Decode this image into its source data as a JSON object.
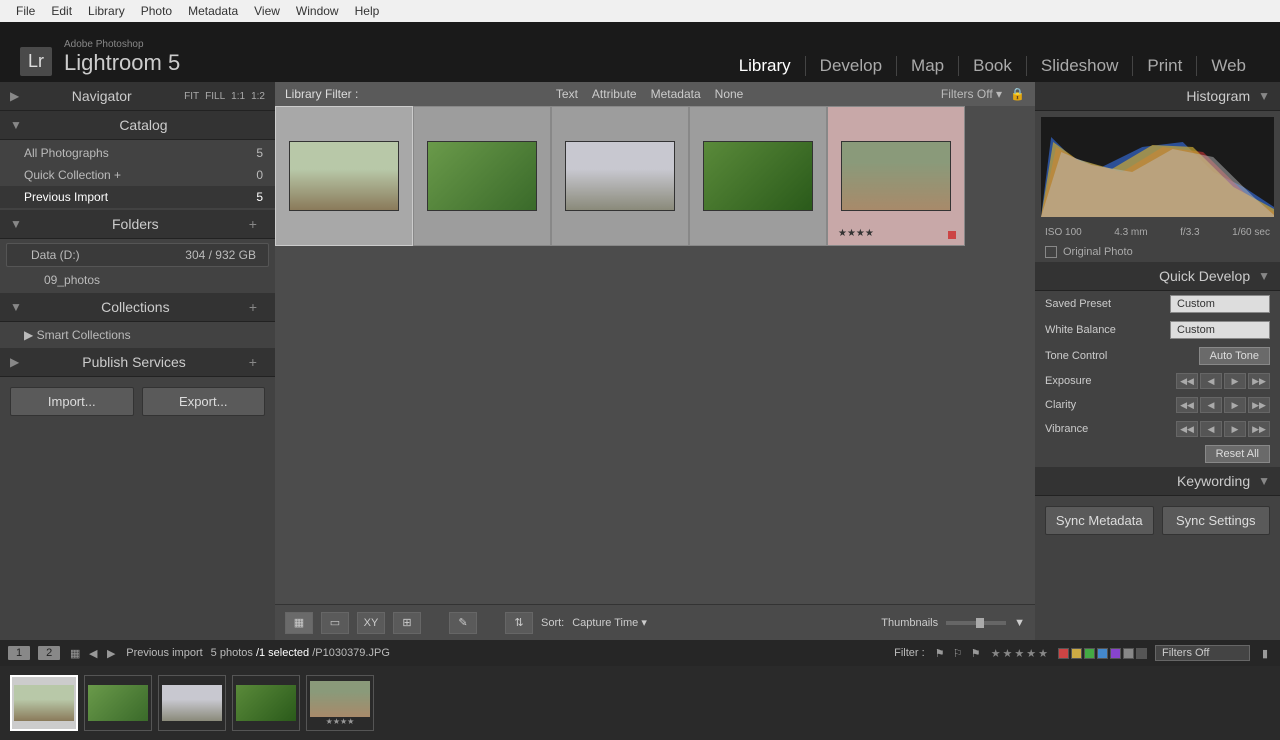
{
  "menubar": {
    "items": [
      "File",
      "Edit",
      "Library",
      "Photo",
      "Metadata",
      "View",
      "Window",
      "Help"
    ]
  },
  "brand": {
    "small": "Adobe Photoshop",
    "big": "Lightroom 5",
    "logo": "Lr"
  },
  "modules": [
    "Library",
    "Develop",
    "Map",
    "Book",
    "Slideshow",
    "Print",
    "Web"
  ],
  "active_module": "Library",
  "navigator": {
    "title": "Navigator",
    "opts": [
      "FIT",
      "FILL",
      "1:1",
      "1:2"
    ]
  },
  "catalog": {
    "title": "Catalog",
    "items": [
      {
        "label": "All Photographs",
        "count": 5
      },
      {
        "label": "Quick Collection  +",
        "count": 0
      },
      {
        "label": "Previous Import",
        "count": 5,
        "selected": true
      }
    ]
  },
  "folders": {
    "title": "Folders",
    "drive": {
      "label": "Data (D:)",
      "space": "304 / 932 GB"
    },
    "children": [
      {
        "label": "09_photos"
      }
    ]
  },
  "collections": {
    "title": "Collections",
    "items": [
      {
        "label": "Smart Collections"
      }
    ]
  },
  "publish": {
    "title": "Publish Services"
  },
  "import_btn": "Import...",
  "export_btn": "Export...",
  "filter": {
    "title": "Library Filter :",
    "tabs": [
      "Text",
      "Attribute",
      "Metadata",
      "None"
    ],
    "off": "Filters Off"
  },
  "thumbs": [
    {
      "cls": "t-house",
      "selected": true
    },
    {
      "cls": "t-leaves"
    },
    {
      "cls": "t-bldg"
    },
    {
      "cls": "t-ferns"
    },
    {
      "cls": "t-path",
      "stars": "★★★★",
      "flagged": true
    }
  ],
  "sort": {
    "label": "Sort:",
    "value": "Capture Time"
  },
  "thumbnails_label": "Thumbnails",
  "histogram": {
    "title": "Histogram",
    "iso": "ISO 100",
    "focal": "4.3 mm",
    "f": "f/3.3",
    "shutter": "1/60 sec",
    "original": "Original Photo"
  },
  "quickdev": {
    "title": "Quick Develop",
    "preset_label": "Saved Preset",
    "preset_val": "Custom",
    "wb_label": "White Balance",
    "wb_val": "Custom",
    "tone_label": "Tone Control",
    "auto": "Auto Tone",
    "sliders": [
      "Exposure",
      "Clarity",
      "Vibrance"
    ],
    "reset": "Reset All"
  },
  "keywording": {
    "title": "Keywording"
  },
  "sync_meta": "Sync Metadata",
  "sync_settings": "Sync Settings",
  "statusbar": {
    "pages": [
      "1",
      "2"
    ],
    "context": "Previous import",
    "count": "5 photos",
    "selected": "/1 selected",
    "file": "/P1030379.JPG",
    "filter_label": "Filter :",
    "filters_off": "Filters Off",
    "chip_colors": [
      "#cc4444",
      "#ccaa44",
      "#44aa44",
      "#4488cc",
      "#8844cc",
      "#888888",
      "#555555"
    ]
  },
  "filmstrip": [
    {
      "cls": "t-house",
      "selected": true
    },
    {
      "cls": "t-leaves"
    },
    {
      "cls": "t-bldg"
    },
    {
      "cls": "t-ferns"
    },
    {
      "cls": "t-path",
      "stars": "★★★★"
    }
  ]
}
